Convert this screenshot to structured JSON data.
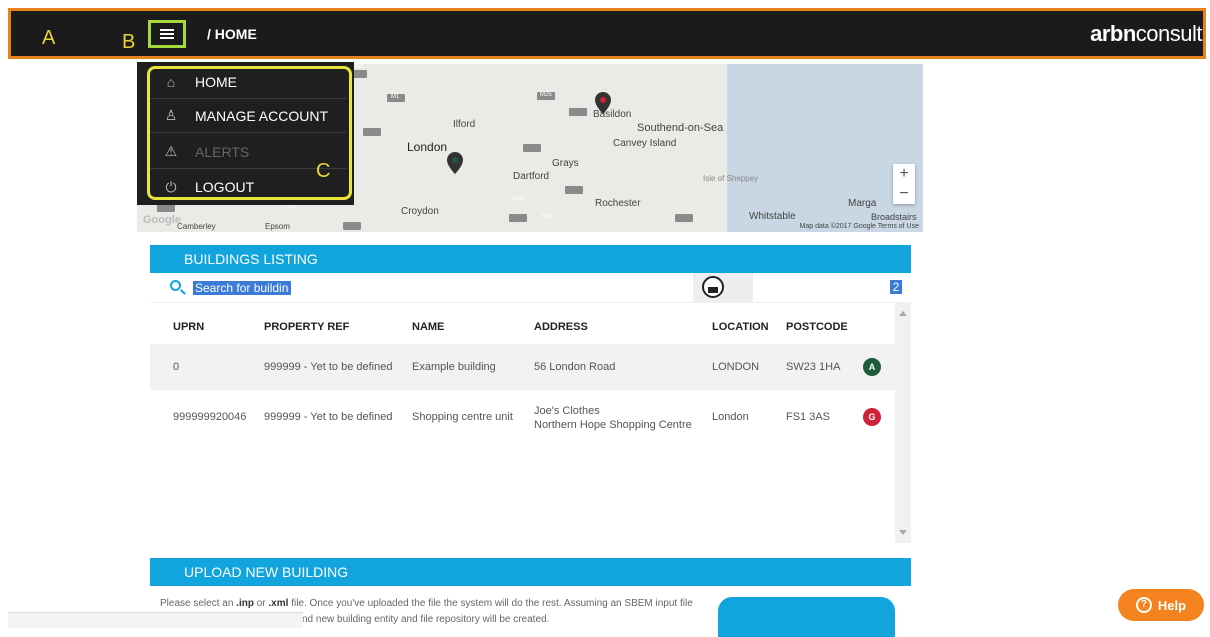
{
  "annotations": {
    "a": "A",
    "b": "B",
    "c": "C"
  },
  "header": {
    "breadcrumb": "/ HOME",
    "brand_bold": "arbn",
    "brand_light": "consult"
  },
  "menu": {
    "items": [
      {
        "label": "HOME",
        "icon": "home-icon"
      },
      {
        "label": "MANAGE ACCOUNT",
        "icon": "user-icon"
      },
      {
        "label": "ALERTS",
        "icon": "warning-icon",
        "disabled": true
      },
      {
        "label": "LOGOUT",
        "icon": "power-icon"
      }
    ]
  },
  "map": {
    "labels": [
      "Ilford",
      "Basildon",
      "Southend-on-Sea",
      "Canvey Island",
      "London",
      "Grays",
      "Dartford",
      "Isle of Sheppey",
      "Rochester",
      "Croydon",
      "Whitstable",
      "Marga",
      "Broadstairs",
      "Camberley",
      "Epsom",
      "Google"
    ],
    "road_labels": [
      "M1",
      "M1",
      "M25",
      "M3",
      "M25",
      "M20"
    ],
    "zoom_in": "+",
    "zoom_out": "−",
    "attribution": "Map data ©2017 Google   Terms of Use"
  },
  "buildings": {
    "title": "BUILDINGS LISTING",
    "search_value": "Search for building",
    "count": "2",
    "columns": [
      "UPRN",
      "PROPERTY REF",
      "NAME",
      "ADDRESS",
      "LOCATION",
      "POSTCODE"
    ],
    "rows": [
      {
        "uprn": "0",
        "property_ref": "999999 - Yet to be defined",
        "name": "Example building",
        "address_line1": "56 London Road",
        "address_line2": "",
        "location": "LONDON",
        "postcode": "SW23 1HA",
        "rating": "A",
        "rating_color": "#1f5c3a"
      },
      {
        "uprn": "999999920046",
        "property_ref": "999999 - Yet to be defined",
        "name": "Shopping centre unit",
        "address_line1": "Joe's Clothes",
        "address_line2": "Northern Hope Shopping Centre",
        "location": "London",
        "postcode": "FS1 3AS",
        "rating": "G",
        "rating_color": "#d0213a"
      }
    ]
  },
  "upload": {
    "title": "UPLOAD NEW BUILDING",
    "text_pre": "Please select an ",
    "ext1": ".inp",
    "text_mid": " or ",
    "ext2": ".xml",
    "text_post": " file. Once you've uploaded the file the system will do the rest. Assuming an SBEM input file",
    "text_line2": "nd new building entity and file repository will be created."
  },
  "help": {
    "label": "Help",
    "icon": "question-icon"
  }
}
